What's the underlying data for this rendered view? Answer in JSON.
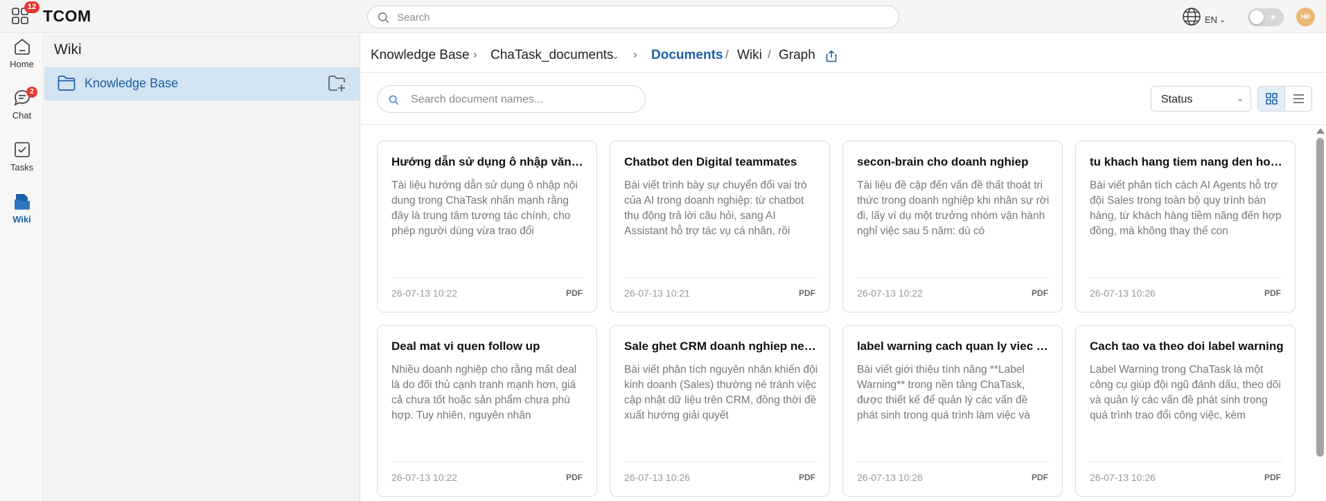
{
  "topbar": {
    "apps_badge": "12",
    "app_title": "TCOM",
    "search_placeholder": "Search",
    "language": "EN",
    "avatar_initials": "HĐ"
  },
  "rail": {
    "items": [
      {
        "label": "Home",
        "icon": "home-icon"
      },
      {
        "label": "Chat",
        "icon": "chat-icon",
        "badge": "2"
      },
      {
        "label": "Tasks",
        "icon": "tasks-icon"
      },
      {
        "label": "Wiki",
        "icon": "wiki-icon",
        "active": true
      }
    ]
  },
  "wiki": {
    "title": "Wiki",
    "folder_label": "Knowledge Base"
  },
  "breadcrumb": {
    "root": "Knowledge Base",
    "collection": "ChaTask_documents",
    "documents": "Documents",
    "wiki": "Wiki",
    "graph": "Graph"
  },
  "toolbar": {
    "doc_search_placeholder": "Search document names...",
    "status_label": "Status"
  },
  "colors": {
    "accent": "#1d5fa6",
    "selected_bg": "#d2e3f1",
    "badge": "#e53935"
  },
  "documents": [
    {
      "title": "Hướng dẫn sử dụng ô nhập văn bản",
      "desc": "Tài liệu hướng dẫn sử dụng ô nhập nội dung trong ChaTask nhấn mạnh rằng đây là trung tâm tương tác chính, cho phép người dùng vừa trao đổi",
      "date": "26-07-13 10:22",
      "type": "PDF"
    },
    {
      "title": "Chatbot den Digital teammates",
      "desc": "Bài viết trình bày sự chuyển đổi vai trò của AI trong doanh nghiệp: từ chatbot thụ động trả lời câu hỏi, sang AI Assistant hỗ trợ tác vụ cá nhân, rồi",
      "date": "26-07-13 10:21",
      "type": "PDF"
    },
    {
      "title": "secon-brain cho doanh nghiep",
      "desc": "Tài liệu đề cập đến vấn đề thất thoát tri thức trong doanh nghiệp khi nhân sự rời đi, lấy ví dụ một trưởng nhóm vận hành nghỉ việc sau 5 năm: dù có",
      "date": "26-07-13 10:22",
      "type": "PDF"
    },
    {
      "title": "tu khach hang tiem nang den hop dong",
      "desc": "Bài viết phân tích cách AI Agents hỗ trợ đội Sales trong toàn bộ quy trình bán hàng, từ khách hàng tiềm năng đến hợp đồng, mà không thay thế con",
      "date": "26-07-13 10:26",
      "type": "PDF"
    },
    {
      "title": "Deal mat vi quen follow up",
      "desc": "Nhiều doanh nghiệp cho rằng mất deal là do đối thủ cạnh tranh mạnh hơn, giá cả chưa tốt hoặc sản phẩm chưa phù hợp. Tuy nhiên, nguyên nhân",
      "date": "26-07-13 10:22",
      "type": "PDF"
    },
    {
      "title": "Sale ghet CRM doanh nghiep nen lam gi",
      "desc": "Bài viết phân tích nguyên nhân khiến đội kinh doanh (Sales) thường né tránh việc cập nhật dữ liệu trên CRM, đồng thời đề xuất hướng giải quyết",
      "date": "26-07-13 10:26",
      "type": "PDF"
    },
    {
      "title": "label warning cach quan ly viec phat sinh",
      "desc": "Bài viết giới thiệu tính năng **Label Warning** trong nền tảng ChaTask, được thiết kế để quản lý các vấn đề phát sinh trong quá trình làm việc và",
      "date": "26-07-13 10:26",
      "type": "PDF"
    },
    {
      "title": "Cach tao va theo doi label warning",
      "desc": "Label Warning trong ChaTask là một công cụ giúp đội ngũ đánh dấu, theo dõi và quản lý các vấn đề phát sinh trong quá trình trao đổi công việc, kèm",
      "date": "26-07-13 10:26",
      "type": "PDF"
    }
  ]
}
